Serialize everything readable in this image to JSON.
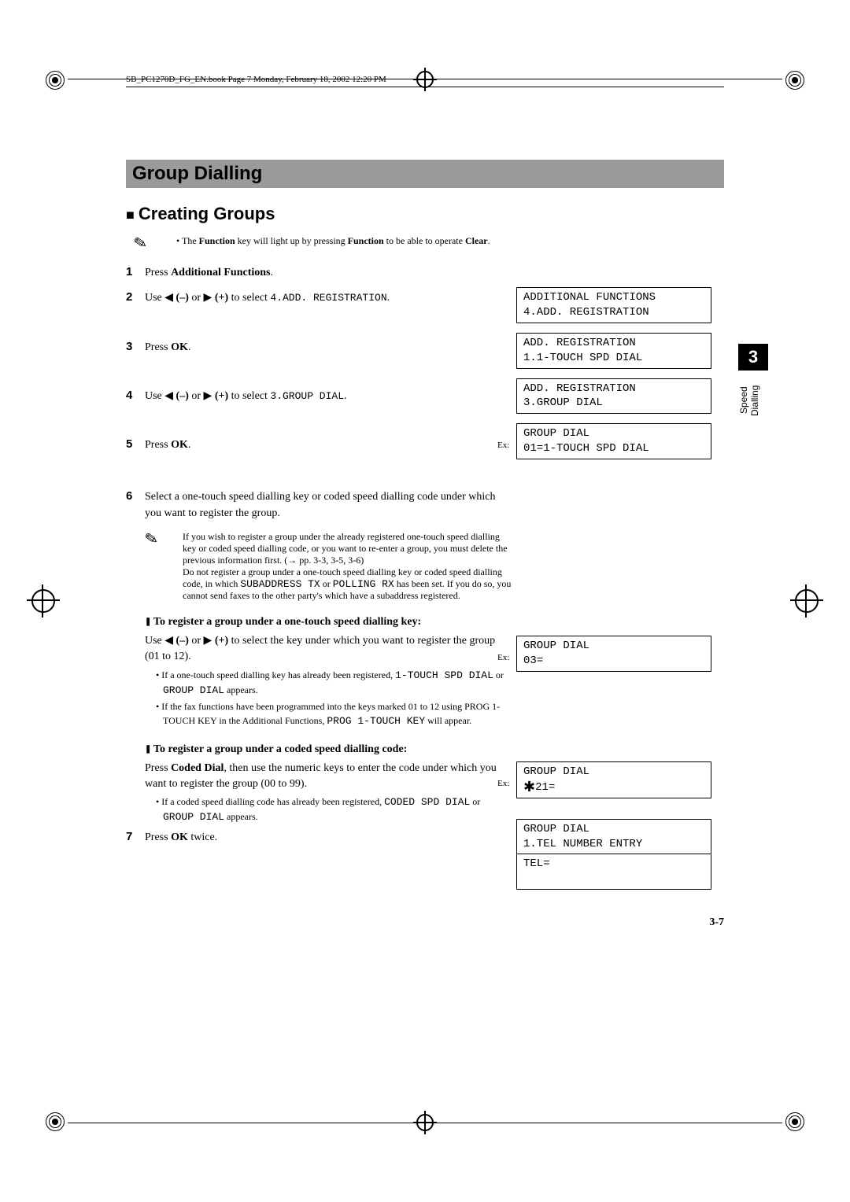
{
  "header_line": "SB_PC1270D_FG_EN.book  Page 7  Monday, February 18, 2002  12:20 PM",
  "title": "Group Dialling",
  "section": "Creating Groups",
  "top_note_prefix": "• The ",
  "top_note_b1": "Function",
  "top_note_mid": " key will light up by pressing ",
  "top_note_b2": "Function",
  "top_note_mid2": " to be able to operate ",
  "top_note_b3": "Clear",
  "top_note_end": ".",
  "step1_a": "Press ",
  "step1_b": "Additional Functions",
  "step1_c": ".",
  "step2_a": "Use ◀ ",
  "step2_b": "(–)",
  "step2_c": " or ▶ ",
  "step2_d": "(+)",
  "step2_e": " to select ",
  "step2_f": "4.ADD. REGISTRATION",
  "step2_g": ".",
  "step3_a": "Press ",
  "step3_b": "OK",
  "step3_c": ".",
  "step4_a": "Use ◀ ",
  "step4_b": "(–)",
  "step4_c": " or ▶ ",
  "step4_d": "(+)",
  "step4_e": " to select ",
  "step4_f": "3.GROUP DIAL",
  "step4_g": ".",
  "step5_a": "Press ",
  "step5_b": "OK",
  "step5_c": ".",
  "step6": "Select a one-touch speed dialling key or coded speed dialling code under which you want to register the group.",
  "note6_1": "If you wish to register a group under the already registered one-touch speed dialling key or coded speed dialling code, or you want to re-enter a group, you must delete the previous information first. (→ pp. 3-3, 3-5, 3-6)",
  "note6_2a": "Do not register a group under a one-touch speed dialling key or coded speed dialling code, in which ",
  "note6_2b": "SUBADDRESS TX",
  "note6_2c": " or ",
  "note6_2d": "POLLING RX",
  "note6_2e": " has been set. If you do so, you cannot send faxes to the other party's which have a subaddress registered.",
  "subA": "To register a group under a one-touch speed dialling key:",
  "subA_body_a": "Use ◀ ",
  "subA_body_b": "(–)",
  "subA_body_c": " or ▶ ",
  "subA_body_d": "(+)",
  "subA_body_e": " to select the key under which you want to register the group (01 to 12).",
  "subA_li1_a": "If a one-touch speed dialling key has already been registered, ",
  "subA_li1_b": "1-TOUCH SPD DIAL",
  "subA_li1_c": " or ",
  "subA_li1_d": "GROUP DIAL",
  "subA_li1_e": " appears.",
  "subA_li2_a": "If the fax functions have been programmed into the keys marked 01 to 12 using PROG 1-TOUCH KEY in the Additional Functions, ",
  "subA_li2_b": "PROG 1-TOUCH KEY",
  "subA_li2_c": " will appear.",
  "subB": "To register a group under a coded speed dialling code:",
  "subB_body_a": "Press ",
  "subB_body_b": "Coded Dial",
  "subB_body_c": ", then use the numeric keys to enter the code under which you want to register the group (00 to 99).",
  "subB_li1_a": "If a coded speed dialling code has already been registered, ",
  "subB_li1_b": "CODED SPD DIAL",
  "subB_li1_c": " or ",
  "subB_li1_d": "GROUP DIAL",
  "subB_li1_e": " appears.",
  "step7_a": "Press ",
  "step7_b": "OK",
  "step7_c": " twice.",
  "lcd1": "ADDITIONAL FUNCTIONS\n4.ADD. REGISTRATION",
  "lcd2": "ADD. REGISTRATION\n1.1-TOUCH SPD DIAL",
  "lcd3": "ADD. REGISTRATION\n3.GROUP DIAL",
  "lcd4": "GROUP DIAL\n01=1-TOUCH SPD DIAL",
  "lcd5": "GROUP DIAL\n03=",
  "lcd6_line1": "GROUP DIAL",
  "lcd6_line2": "21=",
  "lcd7": "GROUP DIAL\n1.TEL NUMBER ENTRY",
  "lcd8": "TEL=\n ",
  "ex": "Ex:",
  "tab_num": "3",
  "tab_text": "Speed Dialling",
  "page_num": "3-7"
}
